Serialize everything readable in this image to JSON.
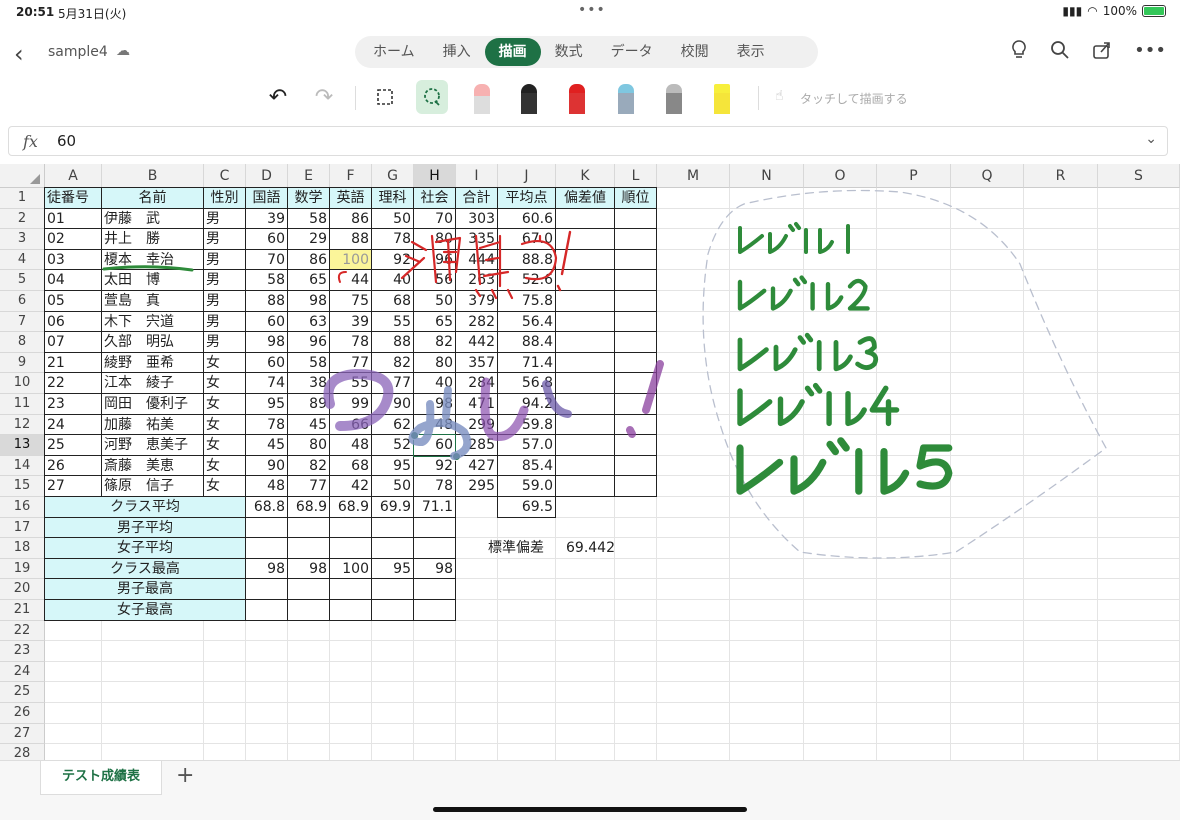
{
  "status": {
    "time": "20:51",
    "date": "5月31日(火)",
    "battery": "100%"
  },
  "topbar": {
    "filename": "sample4",
    "tabs": [
      "ホーム",
      "挿入",
      "描画",
      "数式",
      "データ",
      "校閲",
      "表示"
    ],
    "active_tab": "描画"
  },
  "draw": {
    "touch_label": "タッチして描画する"
  },
  "formula": {
    "fx": "fx",
    "value": "60"
  },
  "columns": [
    "A",
    "B",
    "C",
    "D",
    "E",
    "F",
    "G",
    "H",
    "I",
    "J",
    "K",
    "L",
    "M",
    "N",
    "O",
    "P",
    "Q",
    "R",
    "S"
  ],
  "rows": [
    "1",
    "2",
    "3",
    "4",
    "5",
    "6",
    "7",
    "8",
    "9",
    "10",
    "11",
    "12",
    "13",
    "14",
    "15",
    "16",
    "17",
    "18",
    "19",
    "20",
    "21",
    "22",
    "23",
    "24",
    "25",
    "26",
    "27",
    "28"
  ],
  "headers": [
    "徒番号",
    "名前",
    "性別",
    "国語",
    "数学",
    "英語",
    "理科",
    "社会",
    "合計",
    "平均点",
    "偏差値",
    "順位"
  ],
  "students": [
    [
      "01",
      "伊藤　武",
      "男",
      "39",
      "58",
      "86",
      "50",
      "70",
      "303",
      "60.6"
    ],
    [
      "02",
      "井上　勝",
      "男",
      "60",
      "29",
      "88",
      "78",
      "80",
      "335",
      "67.0"
    ],
    [
      "03",
      "榎本　幸治",
      "男",
      "70",
      "86",
      "100",
      "92",
      "96",
      "444",
      "88.8"
    ],
    [
      "04",
      "太田　博",
      "男",
      "58",
      "65",
      "44",
      "40",
      "56",
      "263",
      "52.6"
    ],
    [
      "05",
      "萱島　真",
      "男",
      "88",
      "98",
      "75",
      "68",
      "50",
      "379",
      "75.8"
    ],
    [
      "06",
      "木下　宍道",
      "男",
      "60",
      "63",
      "39",
      "55",
      "65",
      "282",
      "56.4"
    ],
    [
      "07",
      "久部　明弘",
      "男",
      "98",
      "96",
      "78",
      "88",
      "82",
      "442",
      "88.4"
    ],
    [
      "21",
      "綾野　亜希",
      "女",
      "60",
      "58",
      "77",
      "82",
      "80",
      "357",
      "71.4"
    ],
    [
      "22",
      "江本　綾子",
      "女",
      "74",
      "38",
      "55",
      "77",
      "40",
      "284",
      "56.8"
    ],
    [
      "23",
      "岡田　優利子",
      "女",
      "95",
      "89",
      "99",
      "90",
      "98",
      "471",
      "94.2"
    ],
    [
      "24",
      "加藤　祐美",
      "女",
      "78",
      "45",
      "66",
      "62",
      "48",
      "299",
      "59.8"
    ],
    [
      "25",
      "河野　恵美子",
      "女",
      "45",
      "80",
      "48",
      "52",
      "60",
      "285",
      "57.0"
    ],
    [
      "26",
      "斎藤　美恵",
      "女",
      "90",
      "82",
      "68",
      "95",
      "92",
      "427",
      "85.4"
    ],
    [
      "27",
      "篠原　信子",
      "女",
      "48",
      "77",
      "42",
      "50",
      "78",
      "295",
      "59.0"
    ]
  ],
  "summary": {
    "class_avg_label": "クラス平均",
    "class_avg": [
      "68.8",
      "68.9",
      "68.9",
      "69.9",
      "71.1"
    ],
    "class_avg_j": "69.5",
    "male_avg_label": "男子平均",
    "female_avg_label": "女子平均",
    "class_max_label": "クラス最高",
    "class_max": [
      "98",
      "98",
      "100",
      "95",
      "98"
    ],
    "male_max_label": "男子最高",
    "female_max_label": "女子最高",
    "std_label": "標準偏差",
    "std_value": "69.442"
  },
  "sheet_tab": "テスト成績表",
  "colors": {
    "accent": "#1e7145",
    "header_fill": "#d6f7f9",
    "highlight": "#fbf59a"
  }
}
